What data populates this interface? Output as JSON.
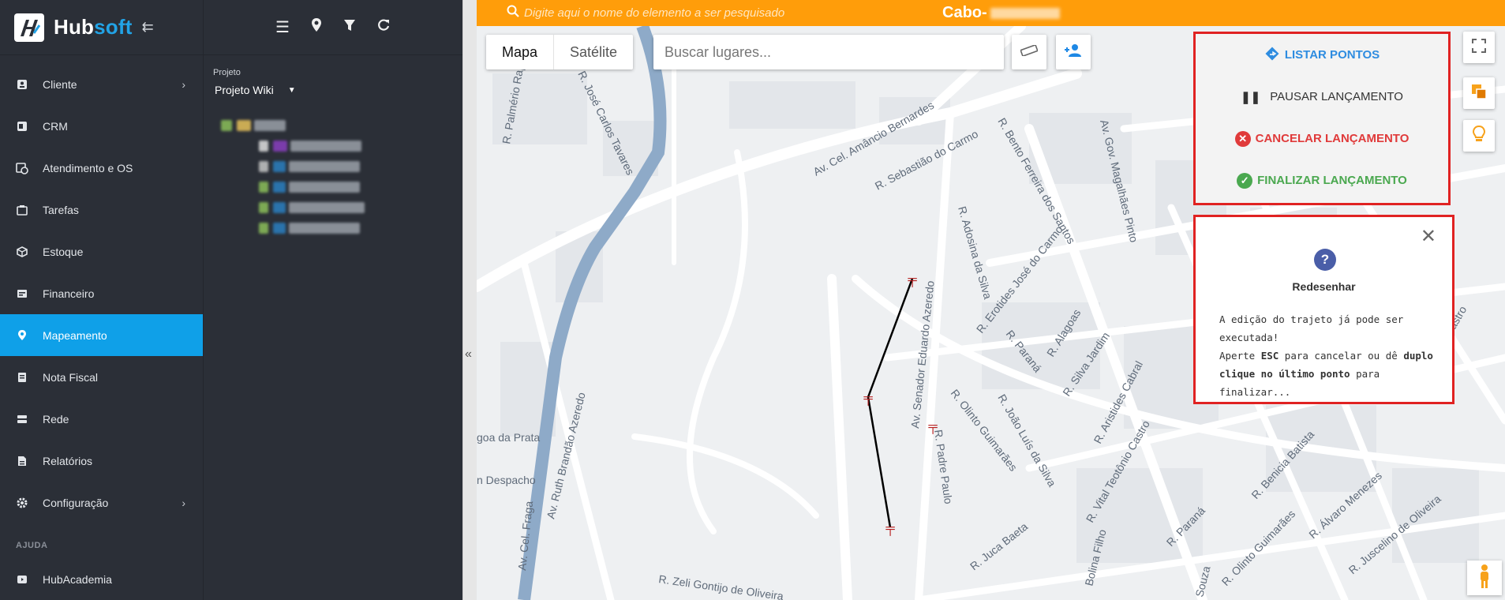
{
  "brand": {
    "name_a": "Hub",
    "name_b": "soft"
  },
  "nav": [
    {
      "label": "Cliente",
      "icon": "id-card-icon",
      "has_submenu": true
    },
    {
      "label": "CRM",
      "icon": "crm-icon",
      "has_submenu": false
    },
    {
      "label": "Atendimento e OS",
      "icon": "calendar-clock-icon",
      "has_submenu": false
    },
    {
      "label": "Tarefas",
      "icon": "tasks-icon",
      "has_submenu": false
    },
    {
      "label": "Estoque",
      "icon": "box-icon",
      "has_submenu": false
    },
    {
      "label": "Financeiro",
      "icon": "money-icon",
      "has_submenu": false
    },
    {
      "label": "Mapeamento",
      "icon": "map-pin-icon",
      "has_submenu": false,
      "active": true
    },
    {
      "label": "Nota Fiscal",
      "icon": "invoice-icon",
      "has_submenu": false
    },
    {
      "label": "Rede",
      "icon": "network-icon",
      "has_submenu": false
    },
    {
      "label": "Relatórios",
      "icon": "report-icon",
      "has_submenu": false
    },
    {
      "label": "Configuração",
      "icon": "gear-icon",
      "has_submenu": true
    }
  ],
  "help_section": {
    "title": "AJUDA",
    "items": [
      {
        "label": "HubAcademia",
        "icon": "play-icon"
      }
    ]
  },
  "project_panel": {
    "label": "Projeto",
    "selected": "Projeto Wiki"
  },
  "topbar": {
    "search_placeholder": "Digite aqui o nome do elemento a ser pesquisado",
    "title": "Cabo-"
  },
  "map_controls": {
    "map_type": [
      "Mapa",
      "Satélite"
    ],
    "map_type_selected": "Mapa",
    "places_placeholder": "Buscar lugares..."
  },
  "actions": {
    "list": "LISTAR PONTOS",
    "pause": "PAUSAR LANÇAMENTO",
    "cancel": "CANCELAR LANÇAMENTO",
    "finish": "FINALIZAR LANÇAMENTO"
  },
  "help_box": {
    "title": "Redesenhar",
    "line1": "A edição do trajeto já pode ser executada!",
    "line2a": "Aperte ",
    "line2b": "ESC",
    "line2c": " para cancelar ou dê ",
    "line2d": "duplo clique no último ponto",
    "line2e": " para finalizar..."
  },
  "streets": [
    "R. Palmério Raposo",
    "R. José Carlos Tavares",
    "Av. Cel. Amâncio Bernardes",
    "R. Sebastião do Carmo",
    "R. Bento Ferreira dos Santos",
    "Av. Gov. Magalhães Pinto",
    "R. Adosina da Silva",
    "R. Erotides José do Carmo",
    "Av. Ruth Brandão Azeredo",
    "Av. Senador Eduardo Azeredo",
    "R. Padre Paulo",
    "R. Alagoas",
    "R. Paraná",
    "R. Silva Jardim",
    "R. Olinto Guimarães",
    "R. João Luís da Silva",
    "R. Aristides Cabral",
    "R. Vital Teotônio Castro",
    "Av. Cel. Fraga",
    "R. Zeli Gontijo de Oliveira",
    "R. Juca Baeta",
    "R. Benicia Batista",
    "R. Álvaro Menezes",
    "R. Juscelino de Oliveira",
    "Teotônio de Castro",
    "goa da Prata",
    "n Despacho",
    "R. Paraná",
    "R. Olinto Guimarães",
    "Bolina Filho",
    "Souza"
  ]
}
